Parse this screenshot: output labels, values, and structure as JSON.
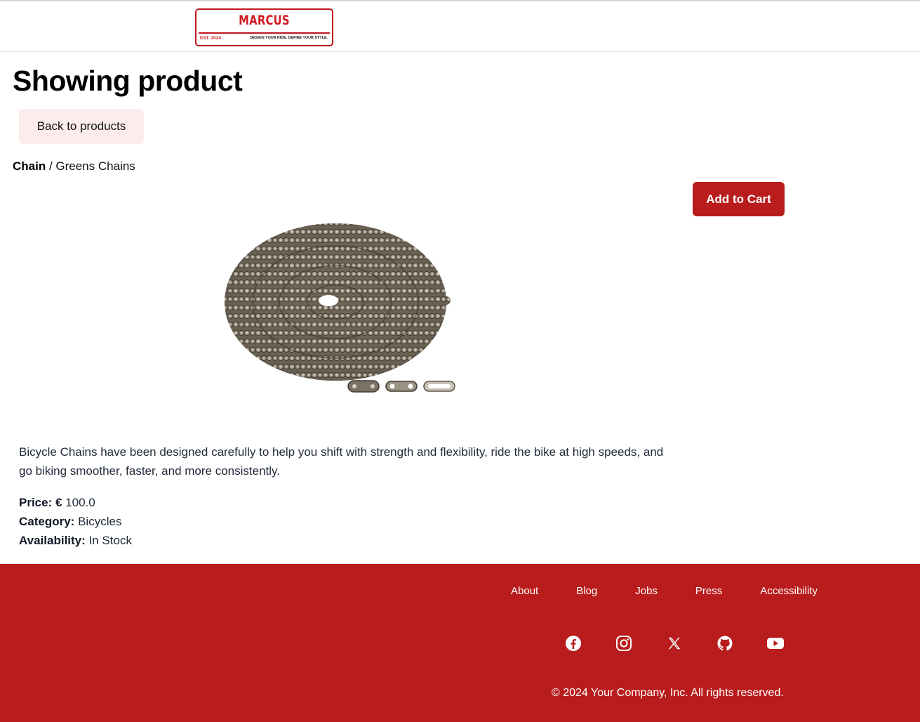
{
  "header": {
    "logo": {
      "brand": "MARCUS",
      "established": "EST. 2024",
      "tagline": "DESIGN YOUR RIDE. DEFINE YOUR STYLE."
    }
  },
  "page": {
    "title": "Showing product",
    "back_button": "Back to products",
    "breadcrumb": {
      "category": "Chain",
      "separator": " / ",
      "product": "Greens Chains"
    },
    "add_to_cart": "Add to Cart"
  },
  "product": {
    "image": "bicycle-chain-image",
    "description": "Bicycle Chains have been designed carefully to help you shift with strength and flexibility, ride the bike at high speeds, and go biking smoother, faster, and more consistently.",
    "price_label": "Price:",
    "price_value": "€ 100.0",
    "category_label": "Category:",
    "category_value": "Bicycles",
    "availability_label": "Availability:",
    "availability_value": "In Stock"
  },
  "footer": {
    "links": [
      "About",
      "Blog",
      "Jobs",
      "Press",
      "Accessibility"
    ],
    "social": [
      "facebook-icon",
      "instagram-icon",
      "x-icon",
      "github-icon",
      "youtube-icon"
    ],
    "copyright": "© 2024 Your Company, Inc. All rights reserved."
  },
  "colors": {
    "brand_red": "#b91c1c",
    "back_button_bg": "#fdecec"
  }
}
